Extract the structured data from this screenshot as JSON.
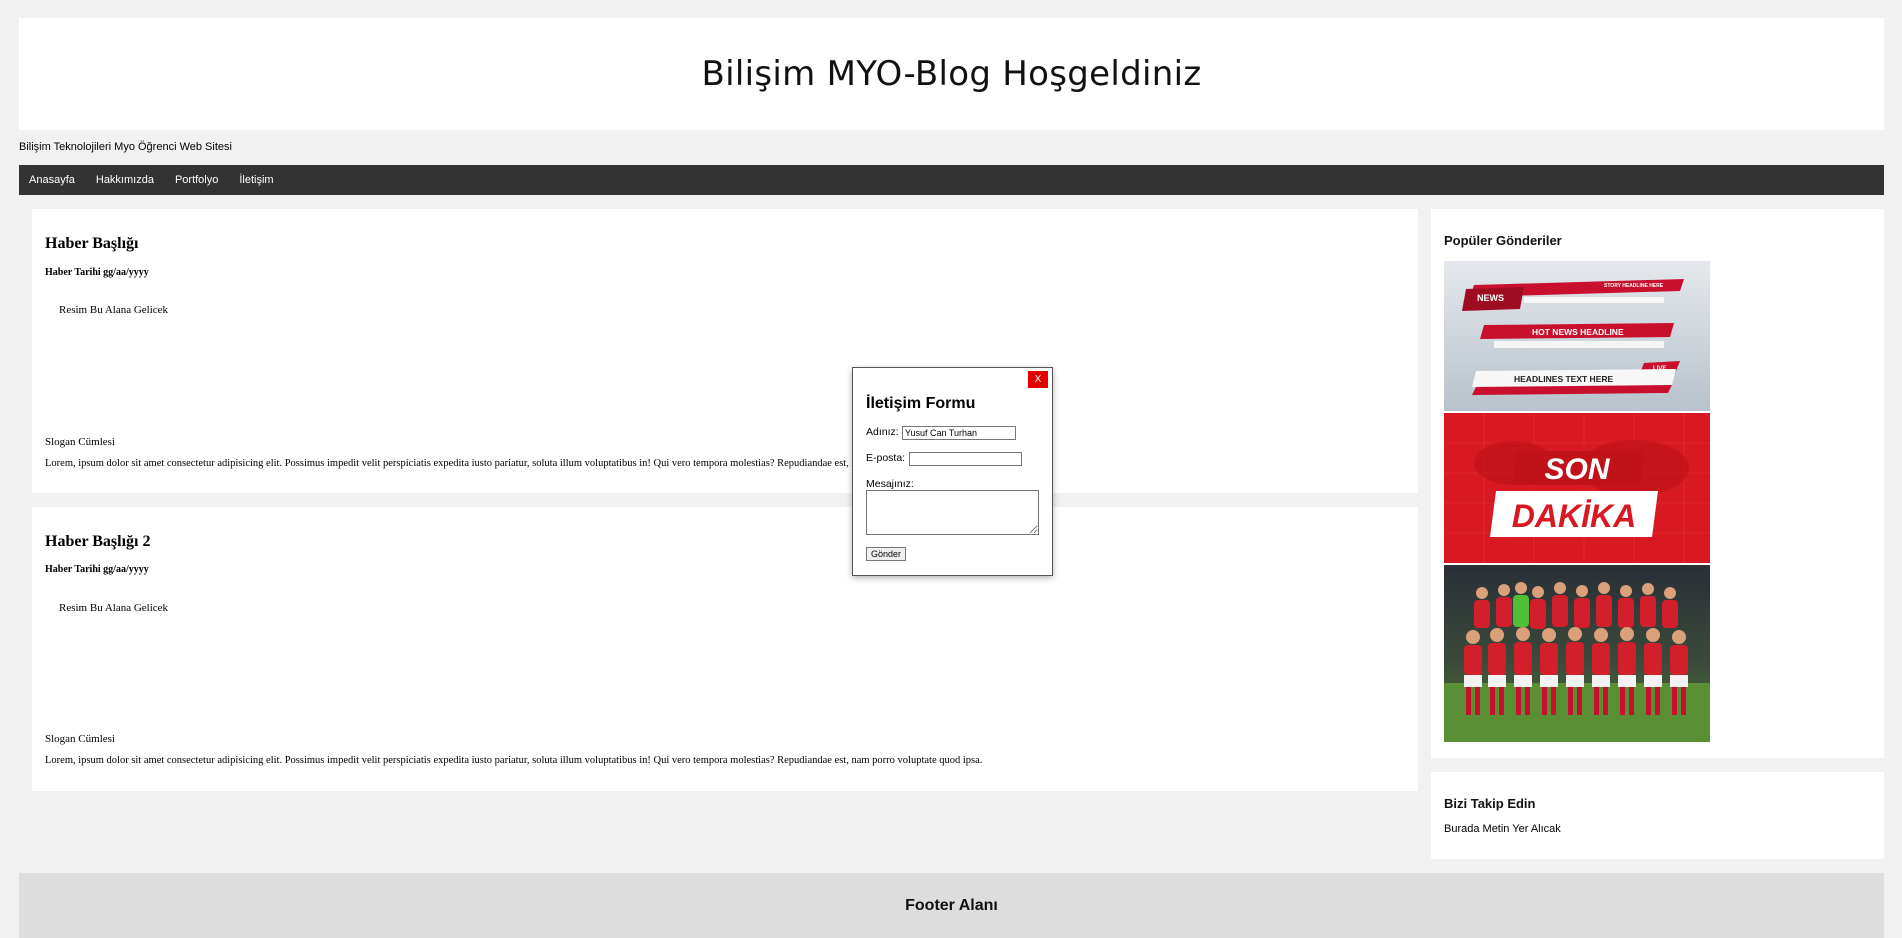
{
  "header": {
    "title": "Bilişim MYO-Blog Hoşgeldiniz"
  },
  "subtitle": "Bilişim Teknolojileri Myo Öğrenci Web Sitesi",
  "nav": {
    "items": [
      "Anasayfa",
      "Hakkımızda",
      "Portfolyo",
      "İletişim"
    ]
  },
  "posts": [
    {
      "title": "Haber Başlığı",
      "date": "Haber Tarihi gg/aa/yyyy",
      "image_placeholder": "Resim Bu Alana Gelicek",
      "slogan": "Slogan Cümlesi",
      "body": "Lorem, ipsum dolor sit amet consectetur adipisicing elit. Possimus impedit velit perspiciatis expedita iusto pariatur, soluta illum voluptatibus in! Qui vero tempora molestias? Repudiandae est, nam porro voluptate quod ipsa."
    },
    {
      "title": "Haber Başlığı 2",
      "date": "Haber Tarihi gg/aa/yyyy",
      "image_placeholder": "Resim Bu Alana Gelicek",
      "slogan": "Slogan Cümlesi",
      "body": "Lorem, ipsum dolor sit amet consectetur adipisicing elit. Possimus impedit velit perspiciatis expedita iusto pariatur, soluta illum voluptatibus in! Qui vero tempora molestias? Repudiandae est, nam porro voluptate quod ipsa."
    }
  ],
  "sidebar": {
    "popular_title": "Popüler Gönderiler",
    "popular_images": [
      {
        "labels": [
          "NEWS",
          "HOT NEWS HEADLINE",
          "HEADLINES TEXT HERE",
          "STORY HEADLINE HERE",
          "LIVE"
        ]
      },
      {
        "labels": [
          "SON",
          "DAKİKA"
        ]
      },
      {
        "labels": []
      }
    ],
    "follow_title": "Bizi Takip Edin",
    "follow_text": "Burada Metin Yer Alıcak"
  },
  "footer": {
    "text": "Footer Alanı"
  },
  "modal": {
    "title": "İletişim Formu",
    "close_label": "X",
    "name_label": "Adınız:",
    "name_value": "Yusuf Can Turhan",
    "email_label": "E-posta:",
    "email_value": "",
    "message_label": "Mesajınız:",
    "submit_label": "Gönder"
  },
  "colors": {
    "nav_bg": "#333333",
    "close_bg": "#e50000",
    "page_bg": "#f1f1f1",
    "footer_bg": "#dddddd"
  }
}
